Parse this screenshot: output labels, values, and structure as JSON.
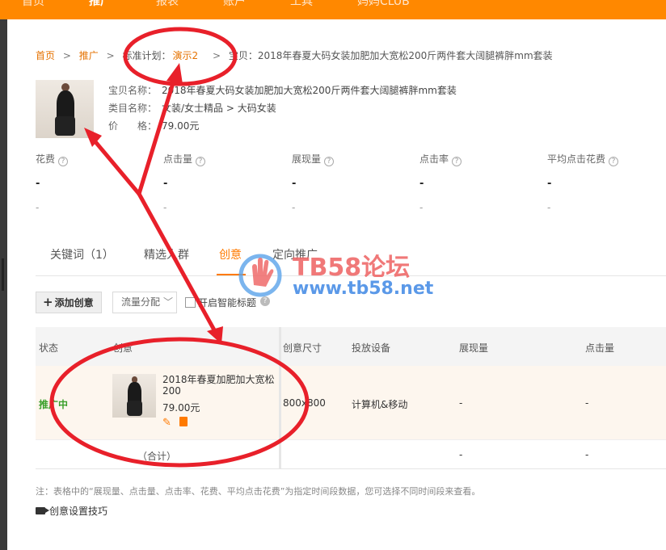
{
  "nav": {
    "items": [
      {
        "label": "首页",
        "active": false
      },
      {
        "label": "推广",
        "active": true
      },
      {
        "label": "报表",
        "active": false
      },
      {
        "label": "账户",
        "active": false
      },
      {
        "label": "工具",
        "active": false
      },
      {
        "label": "妈妈CLUB",
        "active": false
      }
    ]
  },
  "breadcrumb": {
    "home": "首页",
    "promo": "推广",
    "plan_label": "标准计划：",
    "plan_name": "演示2",
    "sep": ">",
    "item": "宝贝：2018年春夏大码女装加肥加大宽松200斤两件套大阔腿裤胖mm套装"
  },
  "product": {
    "name_label": "宝贝名称：",
    "name": "2018年春夏大码女装加肥加大宽松200斤两件套大阔腿裤胖mm套装",
    "category_label": "类目名称：",
    "category": "女装/女士精品 > 大码女装",
    "price_label": "价　　格：",
    "price": "79.00元"
  },
  "metrics": [
    {
      "label": "花费",
      "value": "-",
      "sub": "-"
    },
    {
      "label": "点击量",
      "value": "-",
      "sub": "-"
    },
    {
      "label": "展现量",
      "value": "-",
      "sub": "-"
    },
    {
      "label": "点击率",
      "value": "-",
      "sub": "-"
    },
    {
      "label": "平均点击花费",
      "value": "-",
      "sub": "-"
    }
  ],
  "tabs": [
    {
      "label": "关键词（1）",
      "active": false
    },
    {
      "label": "精选人群",
      "active": false
    },
    {
      "label": "创意",
      "active": true
    },
    {
      "label": "定向推广",
      "active": false
    }
  ],
  "toolbar": {
    "add_label": "添加创意",
    "flow_label": "流量分配",
    "smart_title_label": "开启智能标题"
  },
  "table": {
    "headers": [
      "状态",
      "创意",
      "创意尺寸",
      "投放设备",
      "展现量",
      "点击量"
    ],
    "row": {
      "status": "推广中",
      "title": "2018年春夏加肥加大宽松200",
      "price": "79.00元",
      "size": "800x800",
      "device": "计算机&移动",
      "impressions": "-",
      "clicks": "-"
    },
    "footer": {
      "label": "（合计）",
      "impressions": "-",
      "clicks": "-"
    }
  },
  "note": "注：表格中的“展现量、点击量、点击率、花费、平均点击花费”为指定时间段数据，您可选择不同时间段来查看。",
  "tip_label": "创意设置技巧",
  "watermark": {
    "title": "TB58论坛",
    "url": "www.tb58.net"
  },
  "colors": {
    "brand": "#ff8800",
    "accent": "#ff7a00",
    "link": "#e57200",
    "status_active": "#3a9f2a",
    "annotation": "#e8202a"
  }
}
